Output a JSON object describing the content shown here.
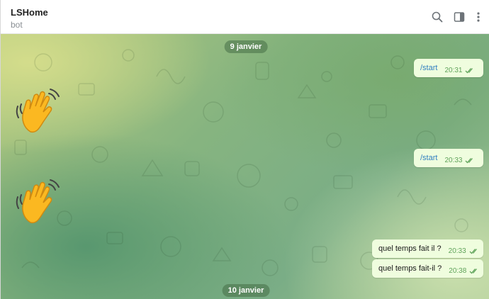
{
  "header": {
    "title": "LSHome",
    "subtitle": "bot",
    "icons": [
      "search-icon",
      "sidebar-toggle-icon",
      "more-vert-icon"
    ]
  },
  "colors": {
    "bubble_out": "#effdde",
    "check": "#5fa35a",
    "command_link": "#2f7ec0",
    "date_pill": "#5b7f58"
  },
  "chat": {
    "date_1": "9 janvier",
    "date_2": "10 janvier",
    "messages": [
      {
        "text": "/start",
        "time": "20:31",
        "is_command": true,
        "status": "read"
      },
      {
        "sticker": "waving-hand-emoji"
      },
      {
        "text": "/start",
        "time": "20:33",
        "is_command": true,
        "status": "read"
      },
      {
        "sticker": "waving-hand-emoji"
      },
      {
        "text": "quel temps fait il ?",
        "time": "20:33",
        "is_command": false,
        "status": "read"
      },
      {
        "text": "quel temps fait-il ?",
        "time": "20:38",
        "is_command": false,
        "status": "read"
      }
    ]
  }
}
